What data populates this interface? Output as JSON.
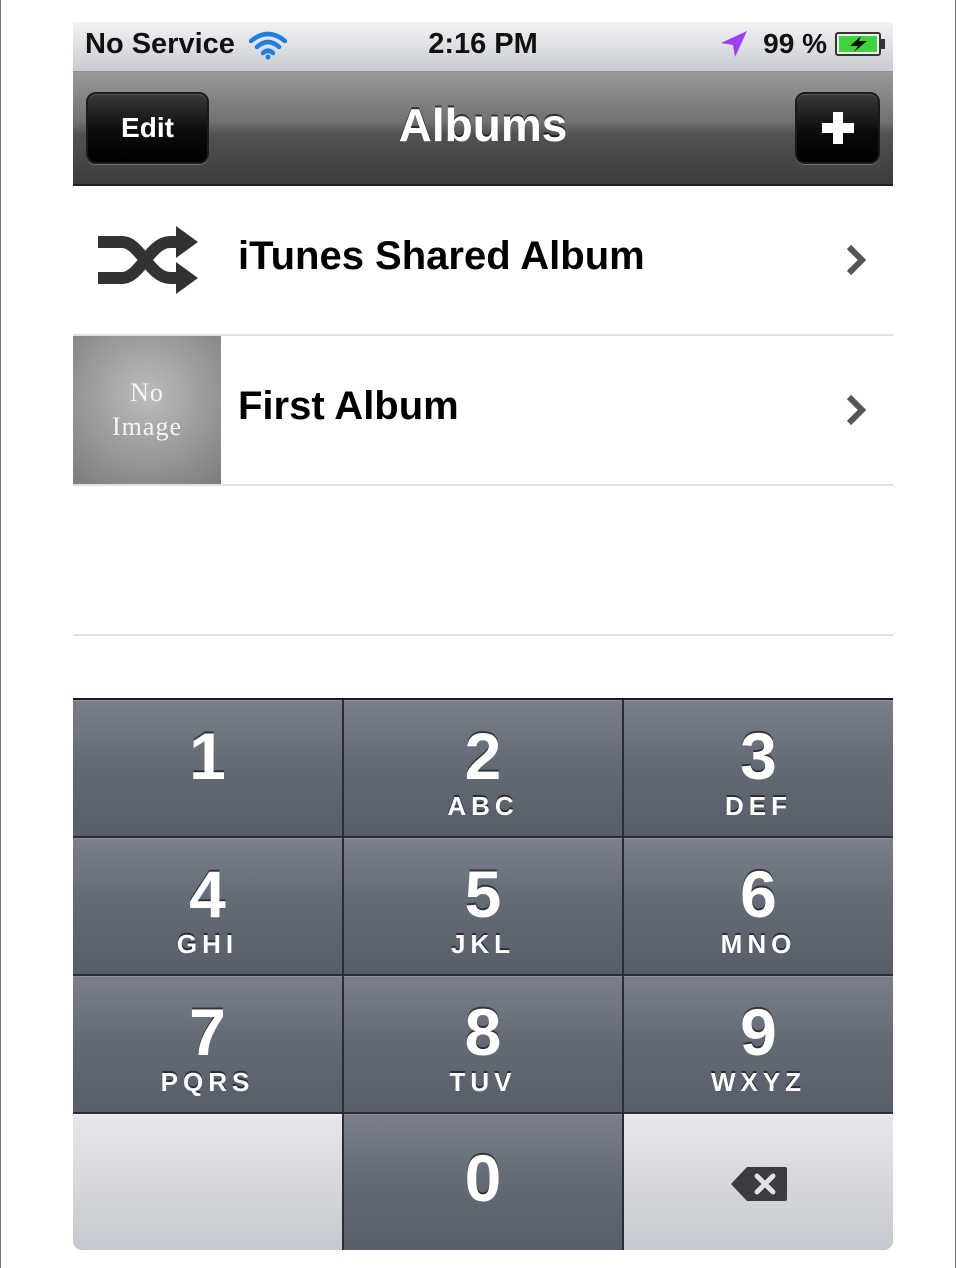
{
  "status_bar": {
    "carrier": "No Service",
    "time": "2:16 PM",
    "battery": "99 %",
    "icons": [
      "wifi-icon",
      "location-arrow-icon",
      "battery-charging-icon"
    ]
  },
  "nav": {
    "title": "Albums",
    "edit_label": "Edit",
    "add_icon": "plus-icon"
  },
  "albums": [
    {
      "label": "iTunes Shared Album",
      "icon": "shuffle-icon"
    },
    {
      "label": "First Album",
      "thumbnail_line1": "No",
      "thumbnail_line2": "Image"
    }
  ],
  "keypad": {
    "keys": [
      {
        "num": "1",
        "letters": ""
      },
      {
        "num": "2",
        "letters": "ABC"
      },
      {
        "num": "3",
        "letters": "DEF"
      },
      {
        "num": "4",
        "letters": "GHI"
      },
      {
        "num": "5",
        "letters": "JKL"
      },
      {
        "num": "6",
        "letters": "MNO"
      },
      {
        "num": "7",
        "letters": "PQRS"
      },
      {
        "num": "8",
        "letters": "TUV"
      },
      {
        "num": "9",
        "letters": "WXYZ"
      },
      {
        "num": "0",
        "letters": ""
      }
    ],
    "delete_icon": "backspace-icon"
  },
  "colors": {
    "key_face": "#646a76",
    "key_light": "#d4d6db",
    "nav_bar": "#5a5a5a",
    "location_arrow": "#9b3ff0",
    "battery_fill": "#3fd33f"
  }
}
